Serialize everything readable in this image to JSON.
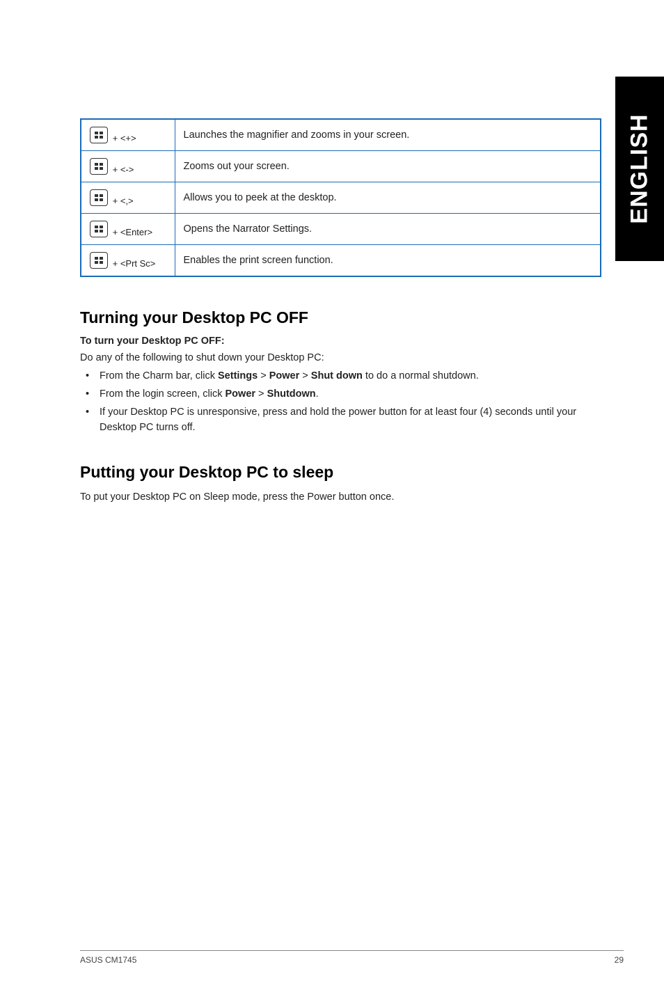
{
  "sideTab": "ENGLISH",
  "shortcuts": [
    {
      "suffix": " + <+>",
      "description": "Launches the magnifier and zooms in your screen."
    },
    {
      "suffix": " + <->",
      "description": "Zooms out your screen."
    },
    {
      "suffix": " + <,>",
      "description": "Allows you to peek at the desktop."
    },
    {
      "suffix": " + <Enter>",
      "description": "Opens the Narrator Settings."
    },
    {
      "suffix": " + <Prt Sc>",
      "description": "Enables the print screen function."
    }
  ],
  "section1": {
    "heading": "Turning your Desktop PC OFF",
    "subheading": "To turn your Desktop PC OFF:",
    "intro": "Do any of the following to shut down your Desktop PC:",
    "bullets": [
      {
        "prefix": "From the Charm bar, click ",
        "b1": "Settings",
        "mid1": " > ",
        "b2": "Power",
        "mid2": " > ",
        "b3": "Shut down",
        "suffix": " to do a normal shutdown."
      },
      {
        "prefix": "From the login screen, click ",
        "b1": "Power",
        "mid1": " > ",
        "b2": "Shutdown",
        "mid2": "",
        "b3": "",
        "suffix": "."
      },
      {
        "prefix": "If your Desktop PC is unresponsive, press and hold the power button for at least four (4) seconds until your Desktop PC turns off.",
        "b1": "",
        "mid1": "",
        "b2": "",
        "mid2": "",
        "b3": "",
        "suffix": ""
      }
    ]
  },
  "section2": {
    "heading": "Putting your Desktop PC to sleep",
    "body": "To put your Desktop PC on Sleep mode, press the Power button once."
  },
  "footer": {
    "left": "ASUS CM1745",
    "right": "29"
  }
}
